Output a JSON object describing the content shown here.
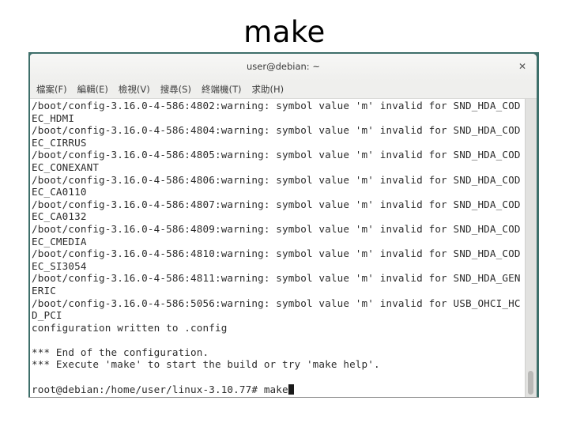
{
  "slide": {
    "title": "make"
  },
  "window": {
    "title": "user@debian: ~",
    "close_icon": "close-icon",
    "menu": [
      {
        "label": "檔案(F)"
      },
      {
        "label": "編輯(E)"
      },
      {
        "label": "檢視(V)"
      },
      {
        "label": "搜尋(S)"
      },
      {
        "label": "終端機(T)"
      },
      {
        "label": "求助(H)"
      }
    ]
  },
  "terminal": {
    "lines": [
      "/boot/config-3.16.0-4-586:4802:warning: symbol value 'm' invalid for SND_HDA_COD",
      "EC_HDMI",
      "/boot/config-3.16.0-4-586:4804:warning: symbol value 'm' invalid for SND_HDA_COD",
      "EC_CIRRUS",
      "/boot/config-3.16.0-4-586:4805:warning: symbol value 'm' invalid for SND_HDA_COD",
      "EC_CONEXANT",
      "/boot/config-3.16.0-4-586:4806:warning: symbol value 'm' invalid for SND_HDA_COD",
      "EC_CA0110",
      "/boot/config-3.16.0-4-586:4807:warning: symbol value 'm' invalid for SND_HDA_COD",
      "EC_CA0132",
      "/boot/config-3.16.0-4-586:4809:warning: symbol value 'm' invalid for SND_HDA_COD",
      "EC_CMEDIA",
      "/boot/config-3.16.0-4-586:4810:warning: symbol value 'm' invalid for SND_HDA_COD",
      "EC_SI3054",
      "/boot/config-3.16.0-4-586:4811:warning: symbol value 'm' invalid for SND_HDA_GEN",
      "ERIC",
      "/boot/config-3.16.0-4-586:5056:warning: symbol value 'm' invalid for USB_OHCI_HC",
      "D_PCI",
      "configuration written to .config",
      "",
      "*** End of the configuration.",
      "*** Execute 'make' to start the build or try 'make help'.",
      ""
    ],
    "prompt": "root@debian:/home/user/linux-3.10.77# ",
    "command": "make"
  },
  "scrollbar": {
    "position_fraction": 1.0
  }
}
